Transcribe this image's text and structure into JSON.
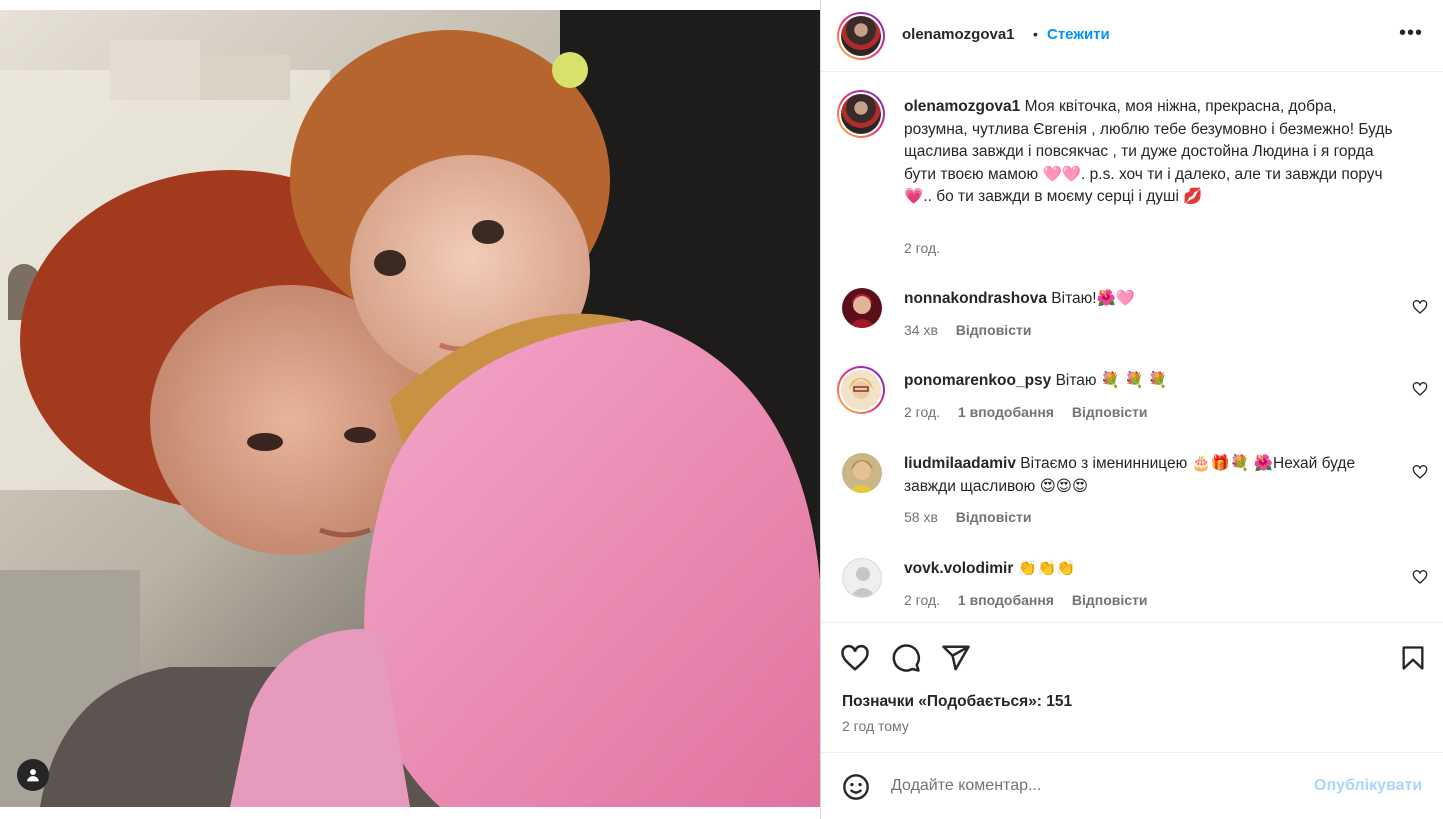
{
  "post": {
    "author": "olenamozgova1",
    "separator": "•",
    "follow_label": "Стежити",
    "more_label": "•••",
    "caption_text": "Моя квіточка, моя ніжна, прекрасна, добра, розумна, чутлива Євгенія , люблю тебе безумовно і безмежно! Будь щаслива завжди і повсякчас , ти дуже достойна Людина і я горда бути твоєю мамою 🩷🩷. p.s. хоч ти і далеко, але ти завжди поруч 💗.. бо ти завжди в моєму серці і душі 💋",
    "caption_time": "2 год."
  },
  "comments": [
    {
      "user": "nonnakondrashova",
      "text": "Вітаю!🌺🩷",
      "time": "34 хв",
      "likes": "",
      "reply": "Відповісти"
    },
    {
      "user": "ponomarenkoo_psy",
      "text": "Вітаю 💐 💐 💐",
      "time": "2 год.",
      "likes": "1 вподобання",
      "reply": "Відповісти"
    },
    {
      "user": "liudmilaadamiv",
      "text": "Вітаємо з іменинницею 🎂🎁💐 🌺Нехай буде завжди щасливою 😍😍😍",
      "time": "58 хв",
      "likes": "",
      "reply": "Відповісти"
    },
    {
      "user": "vovk.volodimir",
      "text": "👏👏👏",
      "time": "2 год.",
      "likes": "1 вподобання",
      "reply": "Відповісти"
    }
  ],
  "footer": {
    "likes_text": "Позначки «Подобається»: 151",
    "post_time": "2 год тому",
    "comment_placeholder": "Додайте коментар...",
    "post_button": "Опублікувати"
  },
  "icons": {
    "like": "heart-icon",
    "comment": "comment-icon",
    "share": "share-icon",
    "save": "bookmark-icon",
    "emoji": "emoji-icon",
    "tag": "user-tag-icon"
  },
  "colors": {
    "accent": "#0095f6",
    "muted": "#737373",
    "post_disabled": "#a7d5fb"
  }
}
